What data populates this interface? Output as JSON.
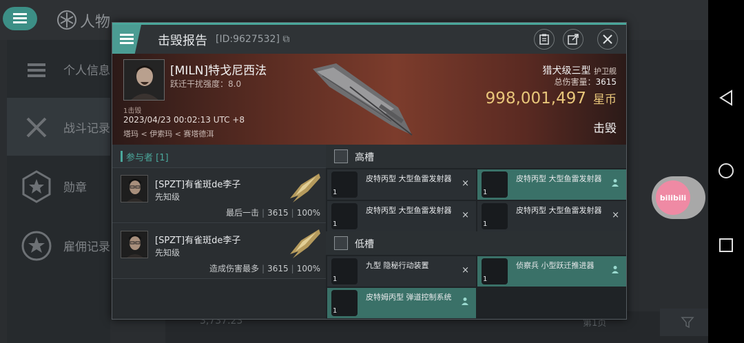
{
  "background": {
    "title": "人物",
    "sidebar": [
      {
        "label": "个人信息",
        "icon": "list-icon"
      },
      {
        "label": "战斗记录",
        "icon": "crossed-swords-icon",
        "active": true
      },
      {
        "label": "勋章",
        "icon": "star-badge-icon"
      },
      {
        "label": "雇佣记录",
        "icon": "star-wreath-icon"
      }
    ],
    "bottom_value": "3,737.23",
    "bottom_page": "第1页"
  },
  "modal": {
    "title": "击毁报告",
    "id_label": "[ID:9627532]",
    "victim": {
      "name": "[MILN]特戈尼西法",
      "warp_strength": "跃迁干扰强度：8.0",
      "kills_tag": "1击毁",
      "datetime": "2023/04/23 00:02:13 UTC +8",
      "location": "塔玛 < 伊索玛 < 赛塔德洱",
      "ship_class": "猎犬级三型",
      "ship_type": "护卫舰",
      "damage_label": "总伤害量：",
      "damage_value": "3615",
      "isk_value": "998,001,497",
      "isk_unit": "星币",
      "result": "击毁"
    },
    "participants_header": "参与者 [1]",
    "participants": [
      {
        "name": "[SPZT]有雀斑de李子",
        "ship": "先知级",
        "role": "最后一击",
        "damage": "3615",
        "percent": "100%"
      },
      {
        "name": "[SPZT]有雀斑de李子",
        "ship": "先知级",
        "role": "造成伤害最多",
        "damage": "3615",
        "percent": "100%"
      }
    ],
    "high_slot_title": "高槽",
    "high_slots": [
      {
        "name": "皮特丙型 大型鱼雷发射器",
        "qty": "1",
        "status": "×",
        "teal": false
      },
      {
        "name": "皮特丙型 大型鱼雷发射器",
        "qty": "1",
        "status": "pilot",
        "teal": true
      },
      {
        "name": "皮特丙型 大型鱼雷发射器",
        "qty": "1",
        "status": "×",
        "teal": false
      },
      {
        "name": "皮特丙型 大型鱼雷发射器",
        "qty": "1",
        "status": "×",
        "teal": false
      }
    ],
    "low_slot_title": "低槽",
    "low_slots": [
      {
        "name": "九型 隐秘行动装置",
        "qty": "1",
        "status": "×",
        "teal": false
      },
      {
        "name": "侦察兵 小型跃迁推进器",
        "qty": "1",
        "status": "pilot",
        "teal": true
      },
      {
        "name": "皮特姆丙型 弹道控制系统",
        "qty": "1",
        "status": "pilot",
        "teal": true
      }
    ]
  },
  "android_nav": {
    "logo_text": "bilibili"
  },
  "colors": {
    "accent": "#4aa79b",
    "isk": "#e8c67a",
    "teal_module": "#3a7168"
  }
}
